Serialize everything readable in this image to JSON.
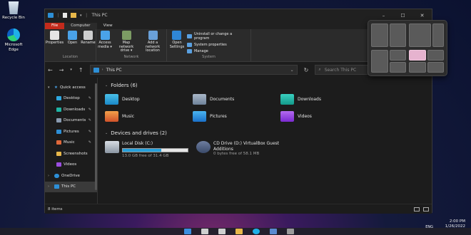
{
  "desktop": {
    "icons": [
      {
        "label": "Recycle Bin",
        "icon": "recycle-bin-icon"
      },
      {
        "label": "Microsoft Edge",
        "icon": "edge-icon"
      }
    ]
  },
  "window": {
    "title": "This PC",
    "controls": {
      "minimize": "–",
      "maximize": "☐",
      "close": "✕"
    }
  },
  "ribbon": {
    "tabs": [
      "File",
      "Computer",
      "View"
    ],
    "groups": [
      {
        "label": "Location",
        "buttons": [
          "Properties",
          "Open",
          "Rename"
        ]
      },
      {
        "label": "Network",
        "buttons": [
          "Access media ▾",
          "Map network drive ▾",
          "Add a network location"
        ]
      },
      {
        "label": "System",
        "buttons": [
          "Open Settings"
        ],
        "list": [
          "Uninstall or change a program",
          "System properties",
          "Manage"
        ]
      }
    ]
  },
  "addressbar": {
    "path": "This PC",
    "search_placeholder": "Search This PC"
  },
  "sidebar": {
    "quick_access": "Quick access",
    "items": [
      {
        "label": "Desktop",
        "pinned": true,
        "color": "#2ea8e0"
      },
      {
        "label": "Downloads",
        "pinned": true,
        "color": "#1fb5a5"
      },
      {
        "label": "Documents",
        "pinned": true,
        "color": "#8a9bb0"
      },
      {
        "label": "Pictures",
        "pinned": true,
        "color": "#2d8fd6"
      },
      {
        "label": "Music",
        "pinned": true,
        "color": "#e0683a"
      },
      {
        "label": "Screenshots",
        "pinned": false,
        "color": "#e8b84a"
      },
      {
        "label": "Videos",
        "pinned": false,
        "color": "#9b4ee0"
      }
    ],
    "onedrive": "OneDrive",
    "this_pc": "This PC"
  },
  "content": {
    "folders_header": "Folders (6)",
    "folders": [
      {
        "label": "Desktop",
        "icon": "desktop-folder-icon"
      },
      {
        "label": "Documents",
        "icon": "documents-folder-icon"
      },
      {
        "label": "Downloads",
        "icon": "downloads-folder-icon"
      },
      {
        "label": "Music",
        "icon": "music-folder-icon"
      },
      {
        "label": "Pictures",
        "icon": "pictures-folder-icon"
      },
      {
        "label": "Videos",
        "icon": "videos-folder-icon"
      }
    ],
    "drives_header": "Devices and drives (2)",
    "drives": [
      {
        "name": "Local Disk (C:)",
        "free": "13.0 GB free of 31.4 GB",
        "used_fraction": 0.59
      },
      {
        "name": "CD Drive (D:) VirtualBox Guest Additions",
        "free": "0 bytes free of 58.1 MB"
      }
    ]
  },
  "status": {
    "items": "8 items"
  },
  "snap_layouts": {
    "highlight_layout": 3,
    "highlight_zone": 1
  },
  "taskbar": {
    "lang": "ENG",
    "time": "2:00 PM",
    "date": "1/26/2022"
  }
}
